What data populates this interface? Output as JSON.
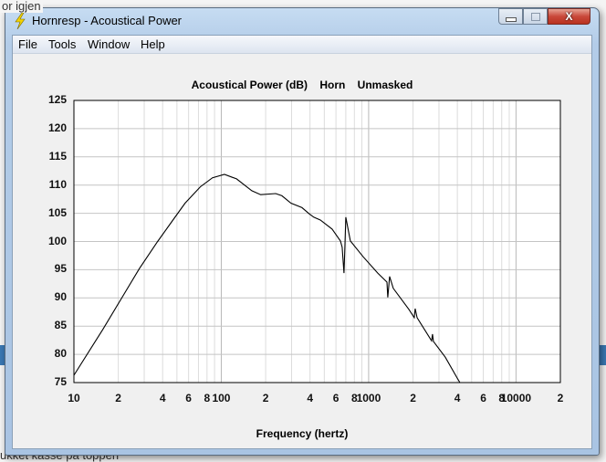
{
  "background": {
    "top_text": "or igjen",
    "bottom_text": "ukket kasse på toppen"
  },
  "window": {
    "title": "Hornresp - Acoustical Power",
    "icon": "lightning-bolt-icon",
    "controls": {
      "minimize": "minimize-icon",
      "maximize": "maximize-icon",
      "close_label": "X"
    }
  },
  "menu": [
    "File",
    "Tools",
    "Window",
    "Help"
  ],
  "chart_data": {
    "type": "line",
    "title": "Acoustical Power (dB)    Horn    Unmasked",
    "xlabel": "Frequency (hertz)",
    "ylabel": "",
    "xscale": "log",
    "xlim": [
      10,
      20000
    ],
    "ylim": [
      75,
      125
    ],
    "grid": true,
    "yticks": [
      75,
      80,
      85,
      90,
      95,
      100,
      105,
      110,
      115,
      120,
      125
    ],
    "xtick_labels": [
      {
        "value": 10,
        "label": "10"
      },
      {
        "value": 20,
        "label": "2"
      },
      {
        "value": 40,
        "label": "4"
      },
      {
        "value": 60,
        "label": "6"
      },
      {
        "value": 80,
        "label": "8"
      },
      {
        "value": 100,
        "label": "100"
      },
      {
        "value": 200,
        "label": "2"
      },
      {
        "value": 400,
        "label": "4"
      },
      {
        "value": 600,
        "label": "6"
      },
      {
        "value": 800,
        "label": "8"
      },
      {
        "value": 1000,
        "label": "1000"
      },
      {
        "value": 2000,
        "label": "2"
      },
      {
        "value": 4000,
        "label": "4"
      },
      {
        "value": 6000,
        "label": "6"
      },
      {
        "value": 8000,
        "label": "8"
      },
      {
        "value": 10000,
        "label": "10000"
      },
      {
        "value": 20000,
        "label": "2"
      }
    ],
    "series": [
      {
        "name": "Acoustical Power",
        "color": "#000000",
        "x": [
          10,
          15.7,
          20.9,
          27.8,
          37,
          47,
          56.8,
          72.1,
          87.1,
          105,
          127,
          161,
          185,
          234,
          258,
          297,
          353,
          395,
          425,
          470,
          565,
          643,
          661,
          680,
          690,
          700,
          752,
          918,
          1153,
          1331,
          1349,
          1388,
          1469,
          1872,
          2040,
          2070,
          2130,
          2675,
          2712,
          2750,
          3310,
          3990,
          4160
        ],
        "y": [
          76.3,
          84.4,
          89.8,
          95.2,
          100.0,
          103.8,
          106.8,
          109.7,
          111.3,
          111.9,
          111.1,
          109.0,
          108.3,
          108.5,
          108.1,
          106.8,
          106.0,
          104.9,
          104.3,
          103.8,
          102.2,
          100.1,
          99.0,
          94.4,
          99.0,
          104.3,
          100.1,
          97.3,
          94.4,
          92.8,
          90.1,
          93.8,
          91.7,
          88.0,
          86.5,
          88.1,
          86.5,
          82.4,
          83.6,
          82.3,
          79.5,
          75.8,
          75.0
        ]
      }
    ]
  }
}
